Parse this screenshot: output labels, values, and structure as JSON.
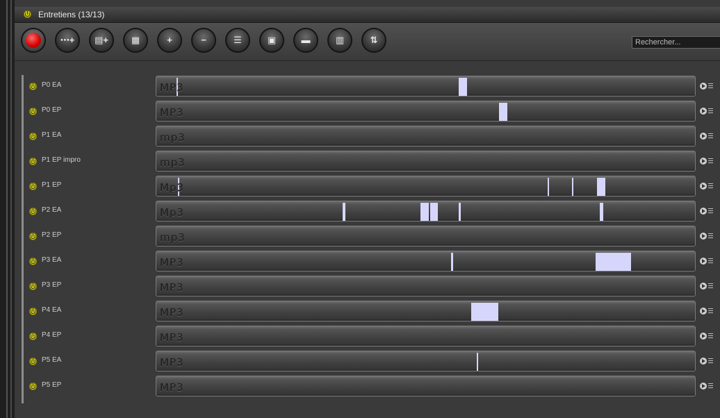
{
  "title": "Entretiens (13/13)",
  "toolbar": {
    "search_placeholder": "Rechercher...",
    "buttons": [
      {
        "name": "record-button",
        "icon": "record-icon",
        "glyph": ""
      },
      {
        "name": "add-media-button",
        "icon": "add-media-icon",
        "glyph": "⋯+"
      },
      {
        "name": "add-track-button",
        "icon": "add-track-icon",
        "glyph": "▤+"
      },
      {
        "name": "add-document-button",
        "icon": "add-document-icon",
        "glyph": "▦"
      },
      {
        "name": "zoom-in-button",
        "icon": "zoom-in-icon",
        "glyph": "+"
      },
      {
        "name": "zoom-out-button",
        "icon": "zoom-out-icon",
        "glyph": "−"
      },
      {
        "name": "list-view-button",
        "icon": "list-view-icon",
        "glyph": "☰"
      },
      {
        "name": "image-view-button",
        "icon": "image-view-icon",
        "glyph": "▣"
      },
      {
        "name": "color-bars-button",
        "icon": "color-bars-icon",
        "glyph": "▬"
      },
      {
        "name": "layout-button",
        "icon": "layout-icon",
        "glyph": "▥"
      },
      {
        "name": "sort-button",
        "icon": "sort-icon",
        "glyph": "⇅"
      }
    ]
  },
  "tracks": [
    {
      "label": "P0 EA",
      "format": "MP3",
      "markers": [
        {
          "s": 0.037,
          "e": 0.039
        },
        {
          "s": 0.561,
          "e": 0.576
        }
      ]
    },
    {
      "label": "P0 EP",
      "format": "MP3",
      "markers": [
        {
          "s": 0.636,
          "e": 0.651
        }
      ]
    },
    {
      "label": "P1 EA",
      "format": "mp3",
      "markers": []
    },
    {
      "label": "P1 EP impro",
      "format": "mp3",
      "markers": []
    },
    {
      "label": "P1 EP",
      "format": "Mp3",
      "markers": [
        {
          "s": 0.04,
          "e": 0.042
        },
        {
          "s": 0.727,
          "e": 0.729
        },
        {
          "s": 0.772,
          "e": 0.774
        },
        {
          "s": 0.818,
          "e": 0.833
        }
      ]
    },
    {
      "label": "P2 EA",
      "format": "Mp3",
      "markers": [
        {
          "s": 0.346,
          "e": 0.351
        },
        {
          "s": 0.49,
          "e": 0.506
        },
        {
          "s": 0.508,
          "e": 0.522
        },
        {
          "s": 0.561,
          "e": 0.565
        },
        {
          "s": 0.823,
          "e": 0.83
        }
      ]
    },
    {
      "label": "P2 EP",
      "format": "mp3",
      "markers": []
    },
    {
      "label": "P3 EA",
      "format": "MP3",
      "markers": [
        {
          "s": 0.547,
          "e": 0.551
        },
        {
          "s": 0.816,
          "e": 0.882
        }
      ]
    },
    {
      "label": "P3 EP",
      "format": "MP3",
      "markers": []
    },
    {
      "label": "P4 EA",
      "format": "MP3",
      "markers": [
        {
          "s": 0.584,
          "e": 0.634
        }
      ]
    },
    {
      "label": "P4 EP",
      "format": "MP3",
      "markers": []
    },
    {
      "label": "P5 EA",
      "format": "MP3",
      "markers": [
        {
          "s": 0.595,
          "e": 0.597
        }
      ]
    },
    {
      "label": "P5 EP",
      "format": "MP3",
      "markers": []
    }
  ]
}
